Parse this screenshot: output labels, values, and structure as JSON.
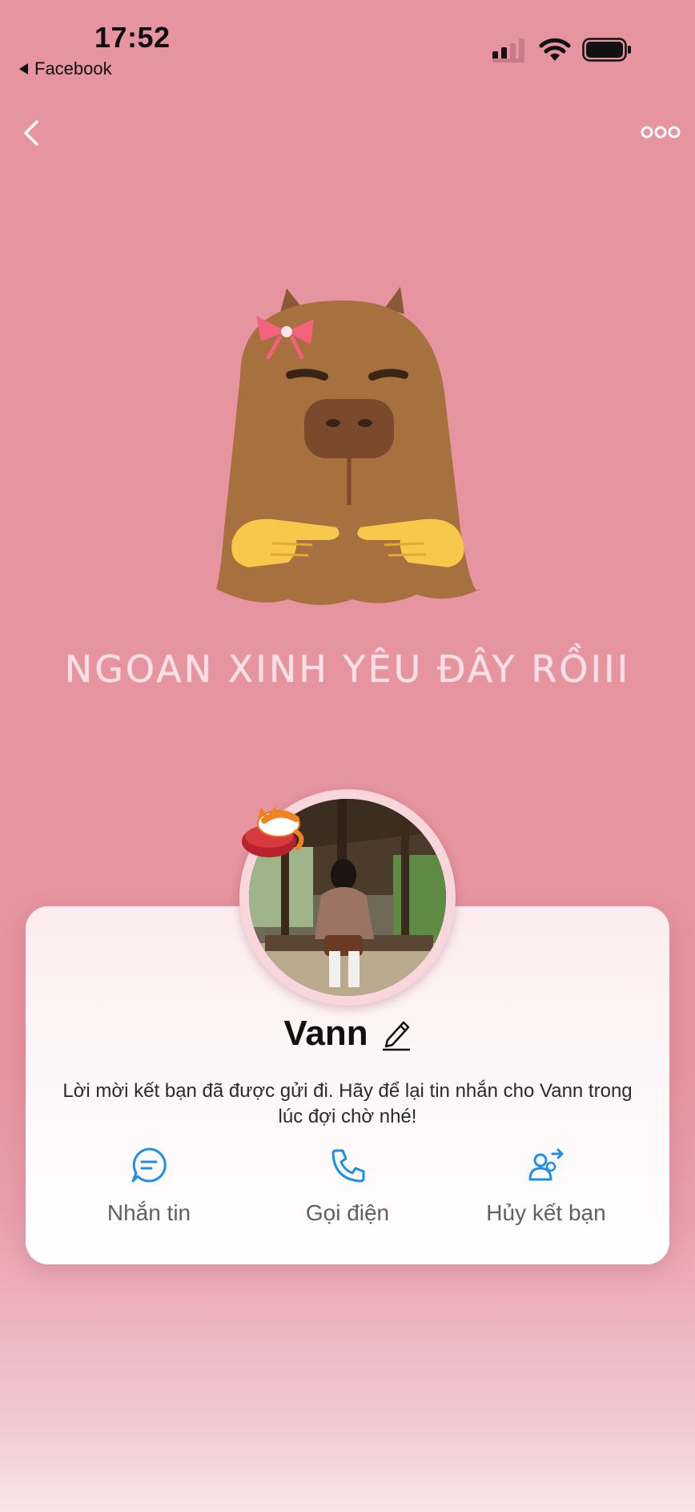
{
  "status_bar": {
    "time": "17:52",
    "back_app": "Facebook"
  },
  "cover": {
    "caption": "NGOAN XINH YÊU ĐÂY RỒIII"
  },
  "profile": {
    "name": "Vann",
    "friend_request_message": "Lời mời kết bạn đã được gửi đi. Hãy để lại tin nhắn cho Vann trong lúc đợi chờ nhé!"
  },
  "actions": [
    {
      "label": "Nhắn tin",
      "icon": "chat-icon"
    },
    {
      "label": "Gọi điện",
      "icon": "phone-icon"
    },
    {
      "label": "Hủy kết bạn",
      "icon": "cancel-friend-icon"
    }
  ],
  "colors": {
    "background": "#e6949f",
    "accent": "#1f8fe5",
    "card": "#fdf5f7"
  }
}
